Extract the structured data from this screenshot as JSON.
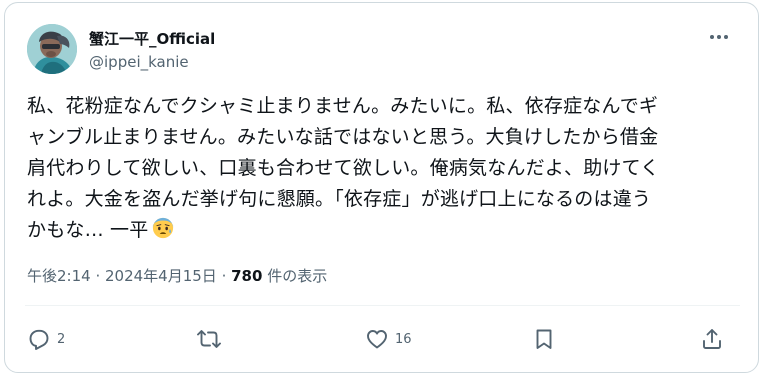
{
  "author": {
    "name": "蟹江一平_Official",
    "handle": "@ippei_kanie",
    "avatar_icon": "profile-photo"
  },
  "tweet": {
    "lines": [
      "私、花粉症なんでクシャミ止まりません。みたいに。私、依存症なんでギ",
      "ャンブル止まりません。みたいな話ではないと思う。大負けしたから借金",
      "肩代わりして欲しい、口裏も合わせて欲しい。俺病気なんだよ、助けてく",
      "れよ。大金を盗んだ挙げ句に懇願。「依存症」が逃げ口上になるのは違う",
      "かもな… 一平"
    ],
    "emoji": "anxious-face-with-sweat"
  },
  "meta": {
    "time": "午後2:14",
    "sep1": " · ",
    "date": "2024年4月15日",
    "sep2": " · ",
    "views": "780",
    "views_label": " 件の表示"
  },
  "actions": {
    "reply_count": "2",
    "retweet_count": "",
    "like_count": "16"
  },
  "colors": {
    "text": "#0f1419",
    "muted": "#536471",
    "border": "#cfd9de"
  }
}
